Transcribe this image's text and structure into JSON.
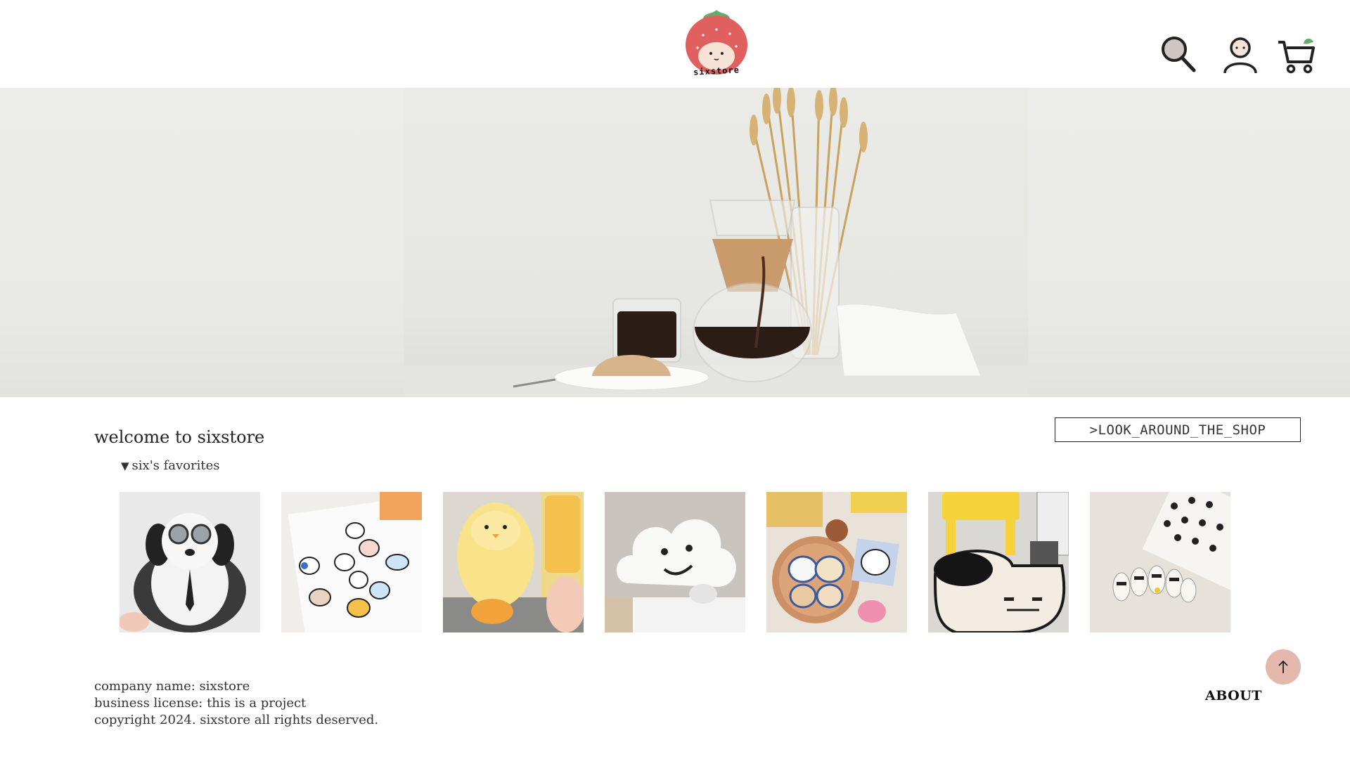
{
  "header": {
    "logo_text": "sixstore",
    "icons": [
      "search-icon",
      "account-icon",
      "cart-icon"
    ]
  },
  "main": {
    "welcome": "welcome to sixstore",
    "favorites_label": "six's favorites",
    "shop_link": ">LOOK_AROUND_THE_SHOP"
  },
  "products": [
    {
      "name": "plush-pilot-dog"
    },
    {
      "name": "animal-patch-stickers"
    },
    {
      "name": "chick-phone-grip"
    },
    {
      "name": "cloud-smile-rug"
    },
    {
      "name": "embroidered-patches"
    },
    {
      "name": "dog-face-rug"
    },
    {
      "name": "character-nail-art"
    }
  ],
  "footer": {
    "company": "company name: sixstore",
    "license": "business license: this is a project",
    "copyright": "copyright 2024. sixstore all rights deserved.",
    "about": "ABOUT"
  },
  "colors": {
    "accent": "#e5b8ad",
    "logo_red": "#e05f5f",
    "logo_green": "#5fae6a",
    "text": "#222222"
  }
}
